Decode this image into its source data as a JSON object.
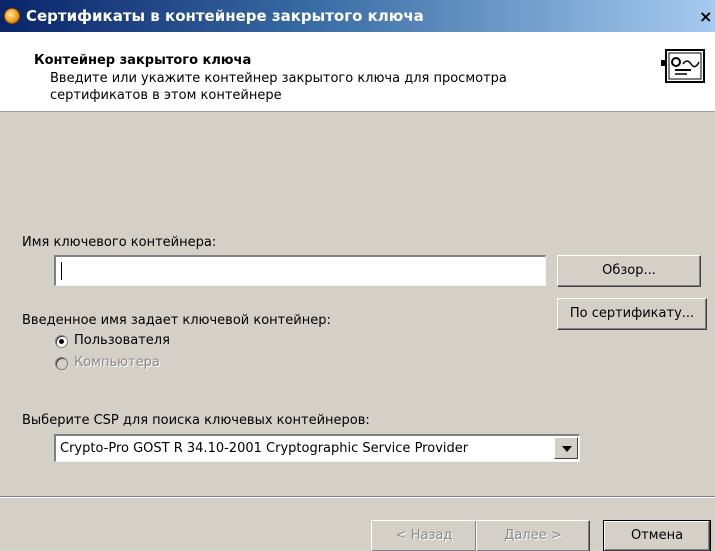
{
  "window": {
    "title": "Сертификаты в контейнере закрытого ключа",
    "close_label": "×"
  },
  "header": {
    "heading": "Контейнер закрытого ключа",
    "description": "Введите или укажите контейнер закрытого ключа для просмотра сертификатов в этом контейнере",
    "icon": "certificate-icon"
  },
  "container": {
    "name_label": "Имя ключевого контейнера:",
    "name_value": "",
    "browse_button": "Обзор...",
    "by_cert_button": "По сертификату..."
  },
  "owner": {
    "label": "Введенное имя задает ключевой контейнер:",
    "options": [
      {
        "label": "Пользователя",
        "selected": true,
        "enabled": true
      },
      {
        "label": "Компьютера",
        "selected": false,
        "enabled": false
      }
    ]
  },
  "csp": {
    "label": "Выберите CSP для поиска ключевых контейнеров:",
    "selected": "Crypto-Pro GOST R 34.10-2001 Cryptographic Service Provider"
  },
  "footer": {
    "back_button": "< Назад",
    "next_button": "Далее >",
    "cancel_button": "Отмена"
  },
  "colors": {
    "titlebar_start": "#0a246a",
    "titlebar_end": "#a6caf0",
    "dialog_bg": "#d4d0c8",
    "header_bg": "#ffffff"
  }
}
